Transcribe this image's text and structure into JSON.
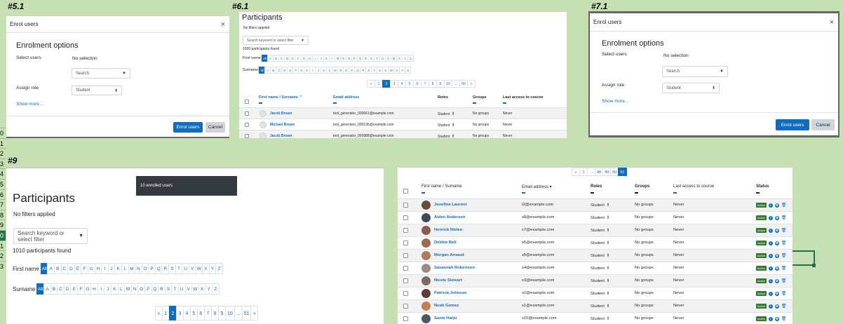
{
  "frames": {
    "f51": "#5.1",
    "f61": "#6.1",
    "f71": "#7.1",
    "f9": "#9"
  },
  "row_numbers": [
    "0",
    "1",
    "2",
    "3",
    "4",
    "5",
    "6",
    "7",
    "8",
    "9",
    "0",
    "1",
    "2",
    "3"
  ],
  "enrol_modal": {
    "title": "Enrol users",
    "close": "×",
    "heading": "Enrolment options",
    "select_users_label": "Select users",
    "select_users_value": "No selection",
    "search_placeholder": "Search",
    "assign_role_label": "Assign role",
    "role_value": "Student",
    "show_more": "Show more...",
    "enrol_button": "Enrol users",
    "cancel_button": "Cancel",
    "caret": "▼",
    "updown": "⬍"
  },
  "participants_small": {
    "title": "Participants",
    "filters": "No filters applied",
    "search_placeholder": "Search keyword or select filter",
    "count": "1000 participants found",
    "first_name_label": "First name",
    "surname_label": "Surname",
    "pages": [
      "«",
      "1",
      "2",
      "3",
      "4",
      "5",
      "6",
      "7",
      "8",
      "9",
      "10",
      "...",
      "50",
      "»"
    ],
    "columns": [
      "First name / Surname ⌃",
      "Email address",
      "Roles",
      "Groups",
      "Last access to course"
    ],
    "rows": [
      {
        "name": "Jacob Brown",
        "email": "tool_generator_000661@example.com",
        "role": "Student",
        "groups": "No groups",
        "access": "Never"
      },
      {
        "name": "Michael Brown",
        "email": "tool_generator_000195@example.com",
        "role": "Student",
        "groups": "No groups",
        "access": "Never"
      },
      {
        "name": "Jacob Brown",
        "email": "tool_generator_000988@example.com",
        "role": "Student",
        "groups": "No groups",
        "access": "Never"
      }
    ]
  },
  "letters": [
    "All",
    "A",
    "B",
    "C",
    "D",
    "E",
    "F",
    "G",
    "H",
    "I",
    "J",
    "K",
    "L",
    "M",
    "N",
    "O",
    "P",
    "Q",
    "R",
    "S",
    "T",
    "U",
    "V",
    "W",
    "X",
    "Y",
    "Z"
  ],
  "participants_large": {
    "title": "Participants",
    "filters": "No filters applied",
    "search_placeholder": "Search keyword or select filter",
    "count": "1010 participants found",
    "first_name_label": "First name",
    "surname_label": "Surname",
    "pages": [
      "«",
      "1",
      "2",
      "3",
      "4",
      "5",
      "6",
      "7",
      "8",
      "9",
      "10",
      "...",
      "51",
      "»"
    ],
    "toast": "10 enrolled users"
  },
  "participants_table": {
    "pages": [
      "«",
      "1",
      "...",
      "48",
      "49",
      "50",
      "51"
    ],
    "columns": [
      "First name / Surname",
      "Email address ▾",
      "Roles",
      "Groups",
      "Last access to course",
      "Status"
    ],
    "badge": "Active",
    "rows": [
      {
        "name": "Josefina Laurent",
        "email": "t2@example.com",
        "role": "Student",
        "groups": "No groups",
        "access": "Never"
      },
      {
        "name": "Aiden Andersen",
        "email": "s8@example.com",
        "role": "Student",
        "groups": "No groups",
        "access": "Never"
      },
      {
        "name": "Henrick Nielen",
        "email": "s7@example.com",
        "role": "Student",
        "groups": "No groups",
        "access": "Never"
      },
      {
        "name": "Debbie Bell",
        "email": "s6@example.com",
        "role": "Student",
        "groups": "No groups",
        "access": "Never"
      },
      {
        "name": "Morgan Arnaud",
        "email": "s5@example.com",
        "role": "Student",
        "groups": "No groups",
        "access": "Never"
      },
      {
        "name": "Savannah Robertson",
        "email": "s4@example.com",
        "role": "Student",
        "groups": "No groups",
        "access": "Never"
      },
      {
        "name": "Nicole Stewart",
        "email": "s3@example.com",
        "role": "Student",
        "groups": "No groups",
        "access": "Never"
      },
      {
        "name": "Patricia Johnson",
        "email": "s2@example.com",
        "role": "Student",
        "groups": "No groups",
        "access": "Never"
      },
      {
        "name": "Noah Gomez",
        "email": "s1@example.com",
        "role": "Student",
        "groups": "No groups",
        "access": "Never"
      },
      {
        "name": "Sanni Harju",
        "email": "s10@example.com",
        "role": "Student",
        "groups": "No groups",
        "access": "Never"
      }
    ]
  },
  "colors": {
    "accent": "#0f6cbf",
    "active": "#357a32",
    "sheet": "#c6e0b4"
  }
}
